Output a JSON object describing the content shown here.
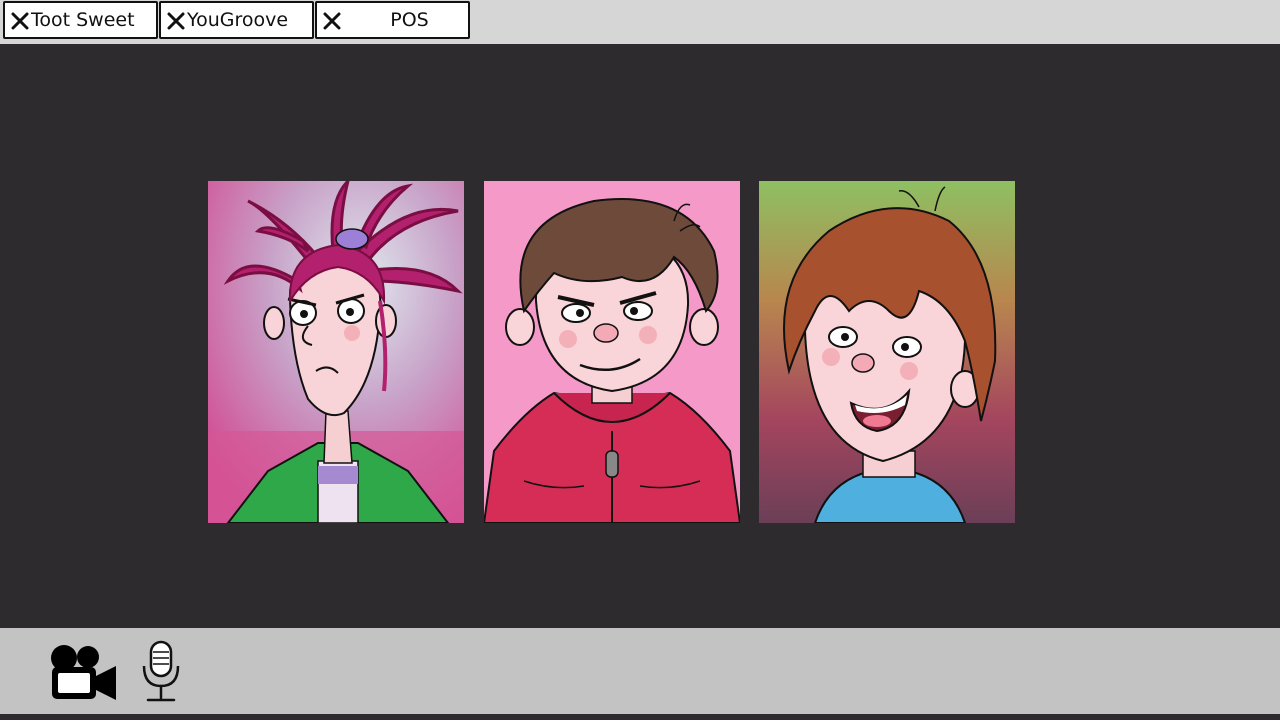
{
  "tabs": [
    {
      "label": "Toot Sweet"
    },
    {
      "label": "YouGroove"
    },
    {
      "label": "POS"
    }
  ],
  "controls": {
    "camera_icon": "video-camera-icon",
    "mic_icon": "microphone-icon"
  },
  "participants": [
    {
      "hair_color": "#b3206e",
      "background": "#d96aa8"
    },
    {
      "hair_color": "#6e4a3a",
      "background": "#f59ac8"
    },
    {
      "hair_color": "#a8512e",
      "background": "#8ec062"
    }
  ],
  "colors": {
    "stage_background": "#2d2b2d",
    "tab_bar": "#d6d6d6",
    "control_bar": "#c3c3c3"
  }
}
